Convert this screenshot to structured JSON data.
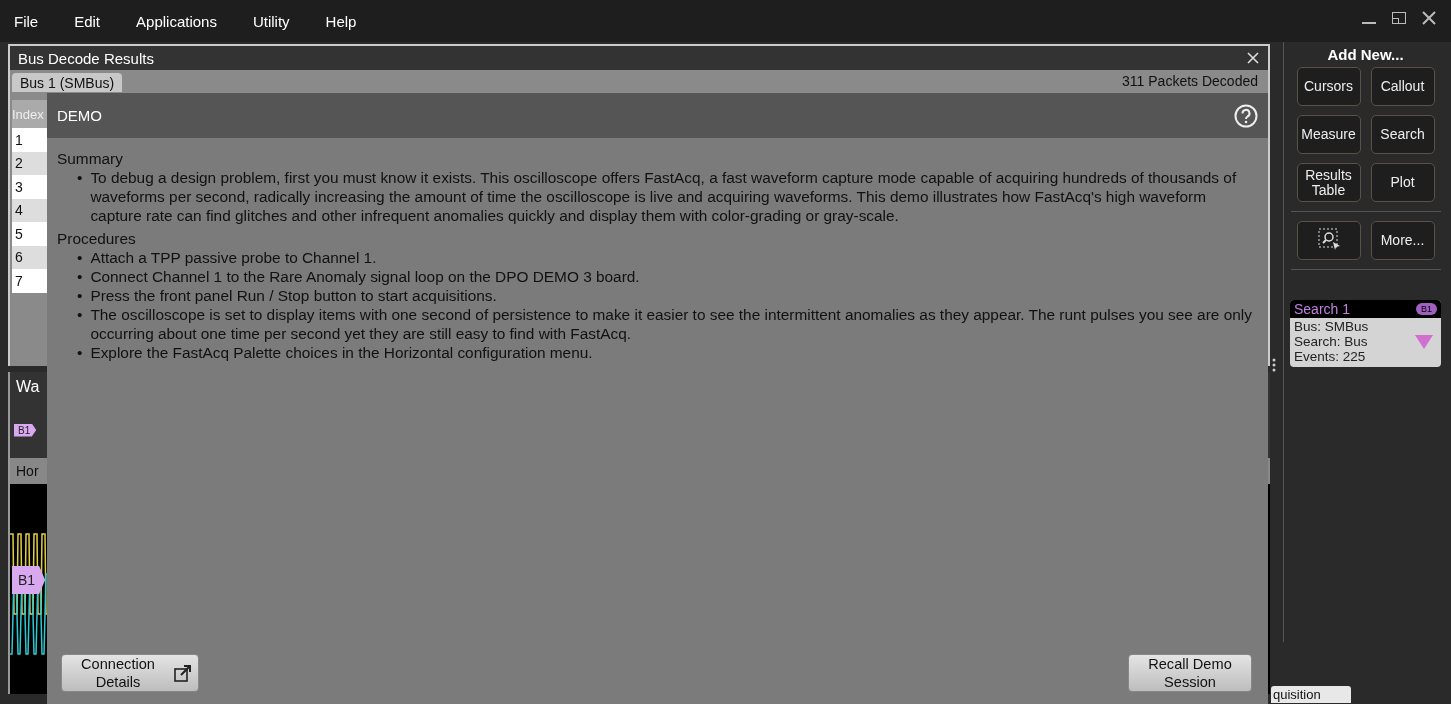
{
  "menu": [
    {
      "label": "File"
    },
    {
      "label": "Edit"
    },
    {
      "label": "Applications"
    },
    {
      "label": "Utility"
    },
    {
      "label": "Help"
    }
  ],
  "bus_decode": {
    "title": "Bus Decode Results",
    "tabs": [
      {
        "label": "Bus 1 (SMBus)",
        "selected": true
      }
    ],
    "status": "311 Packets Decoded",
    "index_header": "Index",
    "row_indices": [
      "1",
      "2",
      "3",
      "4",
      "5",
      "6",
      "7"
    ]
  },
  "waveform_view": {
    "title": "Wa",
    "overview_tag": "B1",
    "zoom_label": "Hor",
    "bus_tag": "B1"
  },
  "side_panel": {
    "title": "Add New...",
    "buttons": [
      {
        "kind": "text",
        "label": "Cursors"
      },
      {
        "kind": "text",
        "label": "Callout"
      },
      {
        "kind": "text",
        "label": "Measure"
      },
      {
        "kind": "text",
        "label": "Search"
      },
      {
        "kind": "text",
        "label": "Results Table"
      },
      {
        "kind": "text",
        "label": "Plot"
      },
      {
        "kind": "icon"
      },
      {
        "kind": "text",
        "label": "More..."
      }
    ],
    "search_card": {
      "title": "Search 1",
      "badge": "B1",
      "lines": [
        "Bus: SMBus",
        "Search: Bus",
        "Events: 225"
      ]
    }
  },
  "bottom_tab": "quisition",
  "dialog": {
    "title": "DEMO",
    "bullet_marker": "•",
    "sections": [
      {
        "heading": "Summary",
        "bullets": [
          "To debug a design problem, first you must know it exists. This oscilloscope offers FastAcq, a fast waveform capture mode capable of acquiring hundreds of thousands of waveforms per second, radically increasing the amount of time the oscilloscope is live and acquiring waveforms. This demo illustrates how FastAcq's high waveform capture rate can find glitches and other infrequent anomalies quickly and display them with color-grading or gray-scale."
        ]
      },
      {
        "heading": "Procedures",
        "bullets": [
          "Attach a TPP passive probe to Channel 1.",
          "Connect Channel 1 to the Rare Anomaly signal loop on the DPO DEMO 3 board.",
          "Press the front panel Run / Stop button to start acquisitions.",
          "The oscilloscope is set to display items with one second of persistence to make it easier to see the intermittent anomalies as they appear. The runt pulses you see are only occurring about one time per second yet they are still easy to find with FastAcq.",
          "Explore the FastAcq Palette choices in the Horizontal configuration menu."
        ]
      }
    ],
    "buttons": [
      {
        "kind": "external",
        "label": "Connection Details"
      },
      {
        "kind": "plain",
        "label": "Recall Demo Session"
      }
    ]
  }
}
